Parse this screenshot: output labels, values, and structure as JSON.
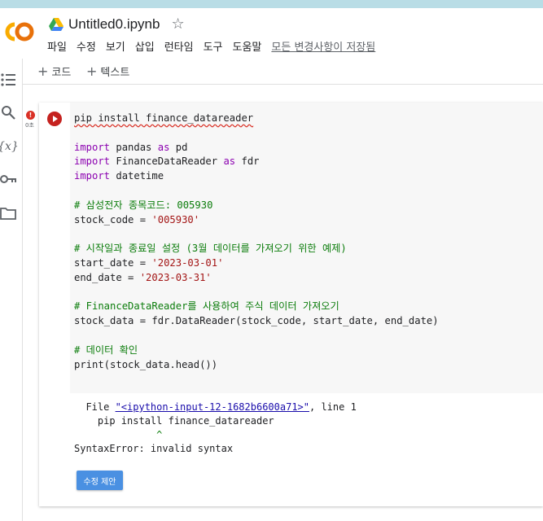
{
  "app": {
    "notebook_title": "Untitled0.ipynb",
    "star_icon": "star-outline-icon",
    "logo_text": "CO",
    "logo_color": "#f9ab00"
  },
  "menu": {
    "items": [
      "파일",
      "수정",
      "보기",
      "삽입",
      "런타임",
      "도구",
      "도움말"
    ],
    "save_status": "모든 변경사항이 저장됨"
  },
  "toolbar": {
    "add_code_label": "코드",
    "add_text_label": "텍스트"
  },
  "sidebar": {
    "icons": [
      "table-of-contents-icon",
      "search-icon",
      "variables-icon",
      "secrets-key-icon",
      "folder-icon"
    ],
    "variables_glyph": "{x}"
  },
  "cell": {
    "exec_time": "0초",
    "error_marker": "!",
    "code_lines": [
      [
        {
          "t": "pip install finance_datareader",
          "c": "plain squiggle"
        }
      ],
      [],
      [
        {
          "t": "import",
          "c": "kw"
        },
        {
          "t": " pandas ",
          "c": "plain"
        },
        {
          "t": "as",
          "c": "kw"
        },
        {
          "t": " pd",
          "c": "plain"
        }
      ],
      [
        {
          "t": "import",
          "c": "kw"
        },
        {
          "t": " FinanceDataReader ",
          "c": "plain"
        },
        {
          "t": "as",
          "c": "kw"
        },
        {
          "t": " fdr",
          "c": "plain"
        }
      ],
      [
        {
          "t": "import",
          "c": "kw"
        },
        {
          "t": " datetime",
          "c": "plain"
        }
      ],
      [],
      [
        {
          "t": "# 삼성전자 종목코드: 005930",
          "c": "cmt"
        }
      ],
      [
        {
          "t": "stock_code = ",
          "c": "plain"
        },
        {
          "t": "'005930'",
          "c": "str"
        }
      ],
      [],
      [
        {
          "t": "# 시작일과 종료일 설정 (3월 데이터를 가져오기 위한 예제)",
          "c": "cmt"
        }
      ],
      [
        {
          "t": "start_date = ",
          "c": "plain"
        },
        {
          "t": "'2023-03-01'",
          "c": "str"
        }
      ],
      [
        {
          "t": "end_date = ",
          "c": "plain"
        },
        {
          "t": "'2023-03-31'",
          "c": "str"
        }
      ],
      [],
      [
        {
          "t": "# FinanceDataReader를 사용하여 주식 데이터 가져오기",
          "c": "cmt"
        }
      ],
      [
        {
          "t": "stock_data = fdr.DataReader(stock_code, start_date, end_date)",
          "c": "plain"
        }
      ],
      [],
      [
        {
          "t": "# 데이터 확인",
          "c": "cmt"
        }
      ],
      [
        {
          "t": "print(stock_data.head())",
          "c": "plain"
        }
      ]
    ]
  },
  "output": {
    "file_prefix": "  File ",
    "file_link": "\"<ipython-input-12-1682b6600a71>\"",
    "file_suffix": ", line 1",
    "source_line": "    pip install finance_datareader",
    "caret_line": "              ^",
    "error_line": "SyntaxError: invalid syntax",
    "fix_button_label": "수정 제안"
  }
}
